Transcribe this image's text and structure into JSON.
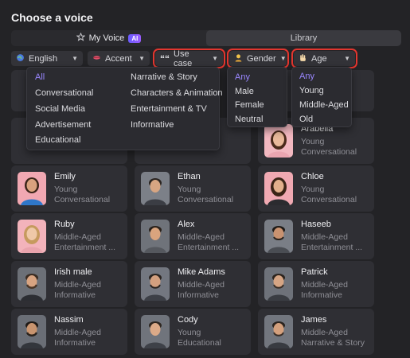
{
  "page_title": "Choose a voice",
  "tabs": {
    "my_voice": "My Voice",
    "ai_badge": "AI",
    "library": "Library"
  },
  "filters": {
    "language": "English",
    "accent": "Accent",
    "use_case": "Use case",
    "gender": "Gender",
    "age": "Age"
  },
  "use_case_menu": {
    "col1": [
      "All",
      "Conversational",
      "Social Media",
      "Advertisement",
      "Educational"
    ],
    "col2": [
      "Narrative & Story",
      "Characters & Animation",
      "Entertainment & TV",
      "Informative"
    ]
  },
  "gender_menu": [
    "Any",
    "Male",
    "Female",
    "Neutral"
  ],
  "age_menu": [
    "Any",
    "Young",
    "Middle-Aged",
    "Old"
  ],
  "voices": [
    {
      "name": "Arabella",
      "age": "Young",
      "type": "Conversational"
    },
    {
      "name": "Emily",
      "age": "Young",
      "type": "Conversational"
    },
    {
      "name": "Ethan",
      "age": "Young",
      "type": "Conversational"
    },
    {
      "name": "Chloe",
      "age": "Young",
      "type": "Conversational"
    },
    {
      "name": "Ruby",
      "age": "Middle-Aged",
      "type": "Entertainment ..."
    },
    {
      "name": "Alex",
      "age": "Middle-Aged",
      "type": "Entertainment ..."
    },
    {
      "name": "Haseeb",
      "age": "Middle-Aged",
      "type": "Entertainment ..."
    },
    {
      "name": "Irish male",
      "age": "Middle-Aged",
      "type": "Informative"
    },
    {
      "name": "Mike Adams",
      "age": "Middle-Aged",
      "type": "Informative"
    },
    {
      "name": "Patrick",
      "age": "Middle-Aged",
      "type": "Informative"
    },
    {
      "name": "Nassim",
      "age": "Middle-Aged",
      "type": "Informative"
    },
    {
      "name": "Cody",
      "age": "Young",
      "type": "Educational"
    },
    {
      "name": "James",
      "age": "Middle-Aged",
      "type": "Narrative & Story"
    }
  ],
  "colors": {
    "accent": "#9a87ff",
    "highlight": "#e2362f",
    "background": "#232326"
  }
}
